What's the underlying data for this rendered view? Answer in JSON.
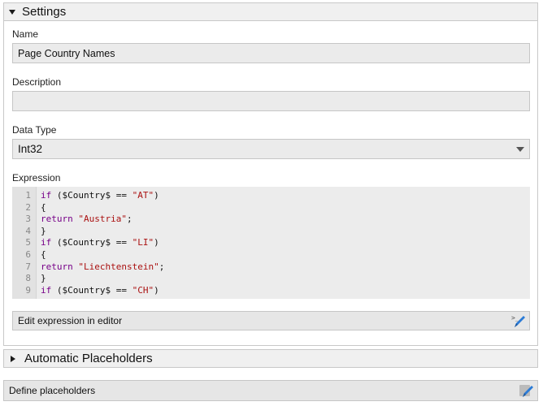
{
  "settings": {
    "title": "Settings",
    "name": {
      "label": "Name",
      "value": "Page Country Names"
    },
    "description": {
      "label": "Description",
      "value": ""
    },
    "data_type": {
      "label": "Data Type",
      "value": "Int32"
    },
    "expression": {
      "label": "Expression",
      "line_numbers": [
        "1",
        "2",
        "3",
        "4",
        "5",
        "6",
        "7",
        "8",
        "9"
      ],
      "lines": [
        [
          {
            "t": "kw",
            "v": "if"
          },
          {
            "t": "p",
            "v": " ($Country$ == "
          },
          {
            "t": "str",
            "v": "\"AT\""
          },
          {
            "t": "p",
            "v": ")"
          }
        ],
        [
          {
            "t": "p",
            "v": "{"
          }
        ],
        [
          {
            "t": "kw",
            "v": "return"
          },
          {
            "t": "p",
            "v": " "
          },
          {
            "t": "str",
            "v": "\"Austria\""
          },
          {
            "t": "p",
            "v": ";"
          }
        ],
        [
          {
            "t": "p",
            "v": "}"
          }
        ],
        [
          {
            "t": "kw",
            "v": "if"
          },
          {
            "t": "p",
            "v": " ($Country$ == "
          },
          {
            "t": "str",
            "v": "\"LI\""
          },
          {
            "t": "p",
            "v": ")"
          }
        ],
        [
          {
            "t": "p",
            "v": "{"
          }
        ],
        [
          {
            "t": "kw",
            "v": "return"
          },
          {
            "t": "p",
            "v": " "
          },
          {
            "t": "str",
            "v": "\"Liechtenstein\""
          },
          {
            "t": "p",
            "v": ";"
          }
        ],
        [
          {
            "t": "p",
            "v": "}"
          }
        ],
        [
          {
            "t": "kw",
            "v": "if"
          },
          {
            "t": "p",
            "v": " ($Country$ == "
          },
          {
            "t": "str",
            "v": "\"CH\""
          },
          {
            "t": "p",
            "v": ")"
          }
        ]
      ],
      "edit_button_label": "Edit expression in editor",
      "edit_icon": "edit-pencil-icon"
    }
  },
  "automatic_placeholders": {
    "title": "Automatic Placeholders"
  },
  "define_placeholders": {
    "label": "Define placeholders",
    "icon": "edit-pencil-icon"
  },
  "colors": {
    "keyword": "#770088",
    "string": "#aa1111",
    "icon_blue": "#2b7bd6"
  }
}
